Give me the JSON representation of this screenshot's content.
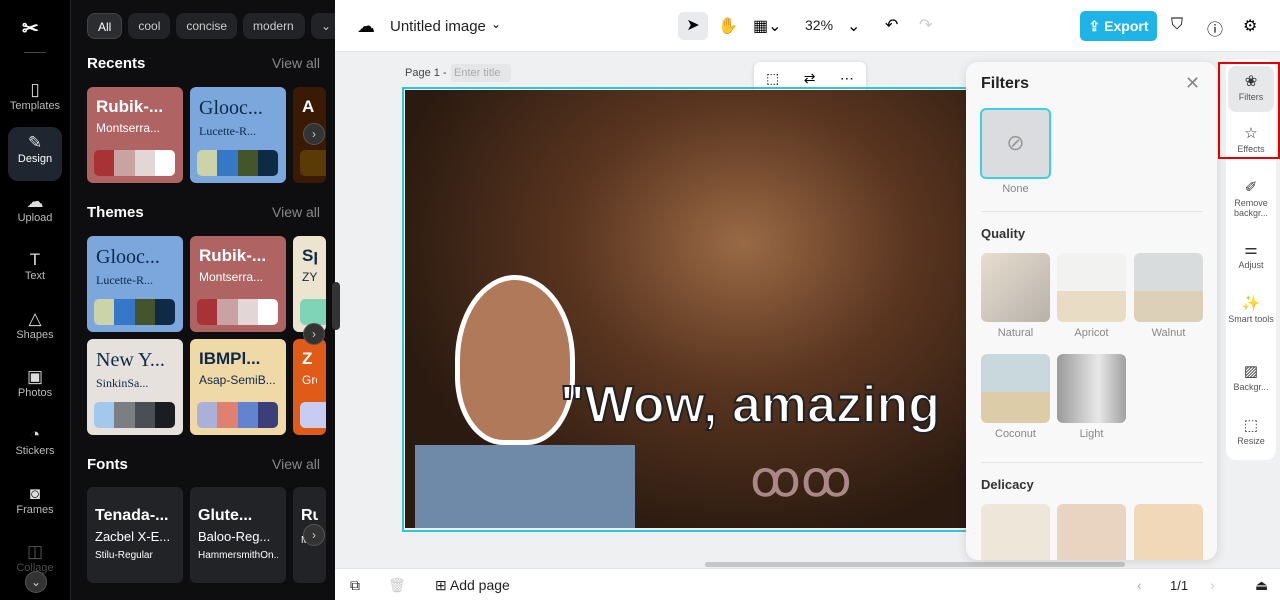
{
  "rail": {
    "items": [
      {
        "label": "Templates",
        "icon": "templates-icon"
      },
      {
        "label": "Design",
        "icon": "design-icon"
      },
      {
        "label": "Upload",
        "icon": "upload-icon"
      },
      {
        "label": "Text",
        "icon": "text-icon"
      },
      {
        "label": "Shapes",
        "icon": "shapes-icon"
      },
      {
        "label": "Photos",
        "icon": "photos-icon"
      },
      {
        "label": "Stickers",
        "icon": "stickers-icon"
      },
      {
        "label": "Frames",
        "icon": "frames-icon"
      },
      {
        "label": "Collage",
        "icon": "collage-icon"
      }
    ]
  },
  "panel": {
    "chips": [
      "All",
      "cool",
      "concise",
      "modern"
    ],
    "recents": {
      "title": "Recents",
      "view_all": "View all",
      "cards": [
        {
          "t1": "Rubik-...",
          "t2": "Montserra...",
          "bg": "#b06363",
          "colors": [
            "#a83236",
            "#c9a3a3",
            "#e2d6d6",
            "#ffffff"
          ]
        },
        {
          "t1": "Glooc...",
          "t2": "Lucette-R...",
          "bg": "#7ba7dd",
          "colors": [
            "#ccd3a8",
            "#3677c8",
            "#45552b",
            "#0e2a45"
          ]
        },
        {
          "t1": "A",
          "t2": "",
          "bg": "#3a1a05",
          "colors": [
            "#5a3a05"
          ]
        }
      ]
    },
    "themes": {
      "title": "Themes",
      "view_all": "View all",
      "cards": [
        {
          "t1": "Glooc...",
          "t2": "Lucette-R...",
          "bg": "#7ba7dd",
          "colors": [
            "#ccd3a8",
            "#3677c8",
            "#45552b",
            "#0e2a45"
          ]
        },
        {
          "t1": "Rubik-...",
          "t2": "Montserra...",
          "bg": "#b06363",
          "colors": [
            "#a83236",
            "#c9a3a3",
            "#e2d6d6",
            "#ffffff"
          ]
        },
        {
          "t1": "Sp",
          "t2": "ZY",
          "bg": "#ece4cf",
          "colors": [
            "#7fd4b8"
          ]
        },
        {
          "t1": "New Y...",
          "t2": "SinkinSa...",
          "bg": "#e6e1dc",
          "colors": [
            "#a3c8ee",
            "#7b7f82",
            "#4a4e55",
            "#1a1d22"
          ]
        },
        {
          "t1": "IBMPl...",
          "t2": "Asap-SemiB...",
          "bg": "#efd9a6",
          "colors": [
            "#aab0d8",
            "#e08070",
            "#6383d0",
            "#3a3f7a"
          ]
        },
        {
          "t1": "Z",
          "t2": "Gro",
          "bg": "#e05a18",
          "colors": [
            "#c8ccf0"
          ]
        }
      ]
    },
    "fonts": {
      "title": "Fonts",
      "view_all": "View all",
      "cards": [
        {
          "l1": "Tenada-...",
          "l2": "Zacbel X-E...",
          "l3": "Stilu-Regular"
        },
        {
          "l1": "Glute...",
          "l2": "Baloo-Reg...",
          "l3": "HammersmithOn..."
        },
        {
          "l1": "Ru",
          "l2": "",
          "l3": "Mor"
        }
      ]
    }
  },
  "top": {
    "title": "Untitled image",
    "zoom": "32%",
    "export": "Export"
  },
  "canvas": {
    "page_label": "Page 1 -",
    "title_placeholder": "Enter title",
    "overlay_text": "\"Wow, amazing"
  },
  "filters": {
    "title": "Filters",
    "none": "None",
    "quality": {
      "title": "Quality",
      "items": [
        "Natural",
        "Apricot",
        "Walnut",
        "Coconut",
        "Light"
      ]
    },
    "delicacy": {
      "title": "Delicacy"
    }
  },
  "right_tools": [
    "Filters",
    "Effects",
    "Remove backgr...",
    "Adjust",
    "Smart tools",
    "Backgr...",
    "Resize"
  ],
  "bottom": {
    "add_page": "Add page",
    "page_count": "1/1"
  },
  "colors": {
    "accent": "#1fb4e8",
    "selection": "#2ec5d8",
    "highlight": "#e00000"
  }
}
